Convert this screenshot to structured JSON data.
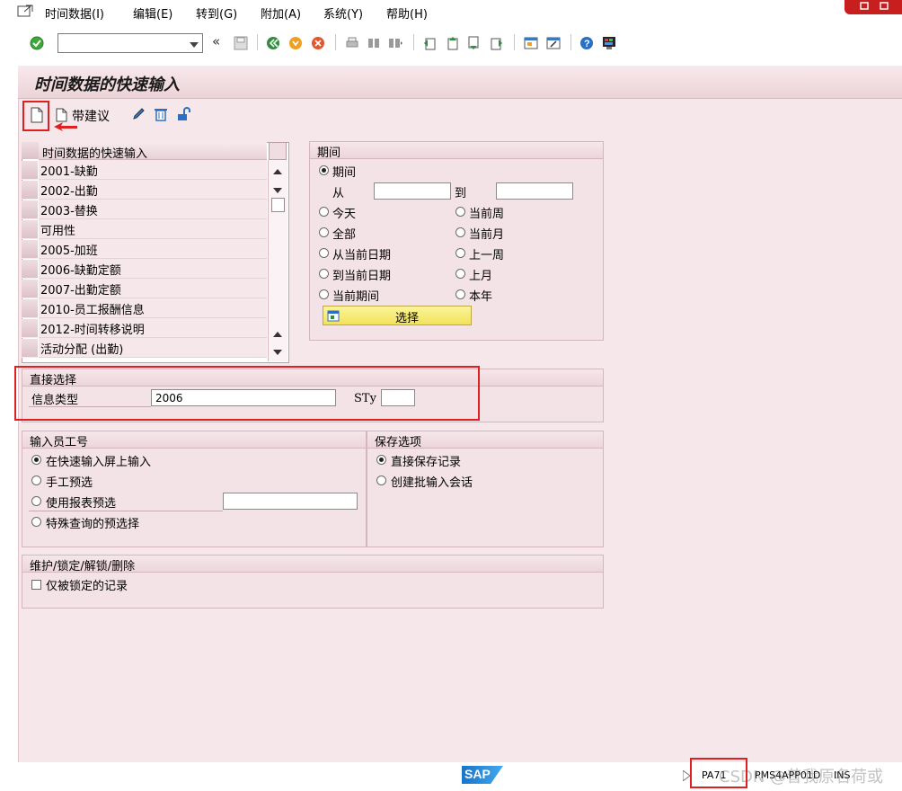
{
  "menu": {
    "items": [
      "时间数据(I)",
      "编辑(E)",
      "转到(G)",
      "附加(A)",
      "系统(Y)",
      "帮助(H)"
    ]
  },
  "toolbar": {
    "command_field_value": "",
    "nav_back_glyph": "«"
  },
  "screen": {
    "title": "时间数据的快速输入"
  },
  "app_toolbar": {
    "create_label": "",
    "with_proposal_label": "带建议"
  },
  "infotype_table": {
    "header": "时间数据的快速输入",
    "rows": [
      "2001-缺勤",
      "2002-出勤",
      "2003-替换",
      "可用性",
      "2005-加班",
      "2006-缺勤定额",
      "2007-出勤定额",
      "2010-员工报酬信息",
      "2012-时间转移说明",
      "活动分配 (出勤)"
    ]
  },
  "period": {
    "title": "期间",
    "period_label": "期间",
    "from_label": "从",
    "to_label": "到",
    "from_value": "",
    "to_value": "",
    "options_left": [
      "今天",
      "全部",
      "从当前日期",
      "到当前日期",
      "当前期间"
    ],
    "options_right": [
      "当前周",
      "当前月",
      "上一周",
      "上月",
      "本年"
    ],
    "select_button": "选择"
  },
  "direct_selection": {
    "title": "直接选择",
    "infotype_label": "信息类型",
    "infotype_value": "2006",
    "subtype_label": "STy",
    "subtype_value": ""
  },
  "personnel_input": {
    "title": "输入员工号",
    "options": [
      "在快速输入屏上输入",
      "手工预选",
      "使用报表预选",
      "特殊查询的预选择"
    ],
    "report_value": ""
  },
  "save_options": {
    "title": "保存选项",
    "options": [
      "直接保存记录",
      "创建批输入会话"
    ]
  },
  "maintain": {
    "title": "维护/锁定/解锁/删除",
    "locked_only_label": "仅被锁定的记录"
  },
  "statusbar": {
    "logo": "SAP",
    "tcode": "PA71",
    "server": "PMS4APP01D",
    "client": "INS",
    "watermark": "CSDN @昔我原名荷或"
  },
  "colors": {
    "accent_red": "#e02020",
    "screen_bg": "#f5e7ea",
    "button_yellow": "#f2e25a"
  }
}
